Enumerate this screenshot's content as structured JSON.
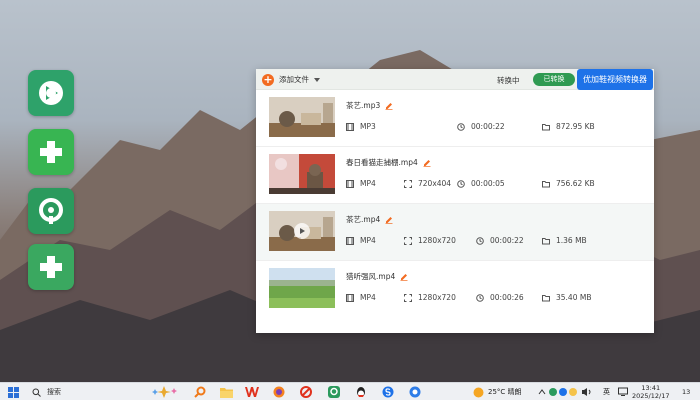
{
  "toolbar": {
    "add_file_label": "添加文件",
    "tab_converting": "转换中",
    "tab_converted": "已转换",
    "promo_button": "优加鞋视频转换器"
  },
  "files": [
    {
      "name": "茶艺.mp3",
      "format": "MP3",
      "resolution": "",
      "duration": "00:00:22",
      "size": "872.95 KB"
    },
    {
      "name": "春日看猫走捕棚.mp4",
      "format": "MP4",
      "resolution": "720x404",
      "duration": "00:00:05",
      "size": "756.62 KB"
    },
    {
      "name": "茶艺.mp4",
      "format": "MP4",
      "resolution": "1280x720",
      "duration": "00:00:22",
      "size": "1.36 MB"
    },
    {
      "name": "猎听强风.mp4",
      "format": "MP4",
      "resolution": "1280x720",
      "duration": "00:00:26",
      "size": "35.40 MB"
    }
  ],
  "taskbar": {
    "search_label": "搜索",
    "weather": "25°C 晴朗",
    "ime": "英",
    "time": "13:41",
    "date": "2025/12/17",
    "notification_count": "13"
  },
  "desktop_icons": [
    "video-converter-icon",
    "green-plus-icon-1",
    "circle-q-icon",
    "green-plus-icon-2"
  ],
  "colors": {
    "accent_blue": "#1e72e8",
    "accent_green": "#2f9a52",
    "accent_orange": "#f26b21"
  }
}
